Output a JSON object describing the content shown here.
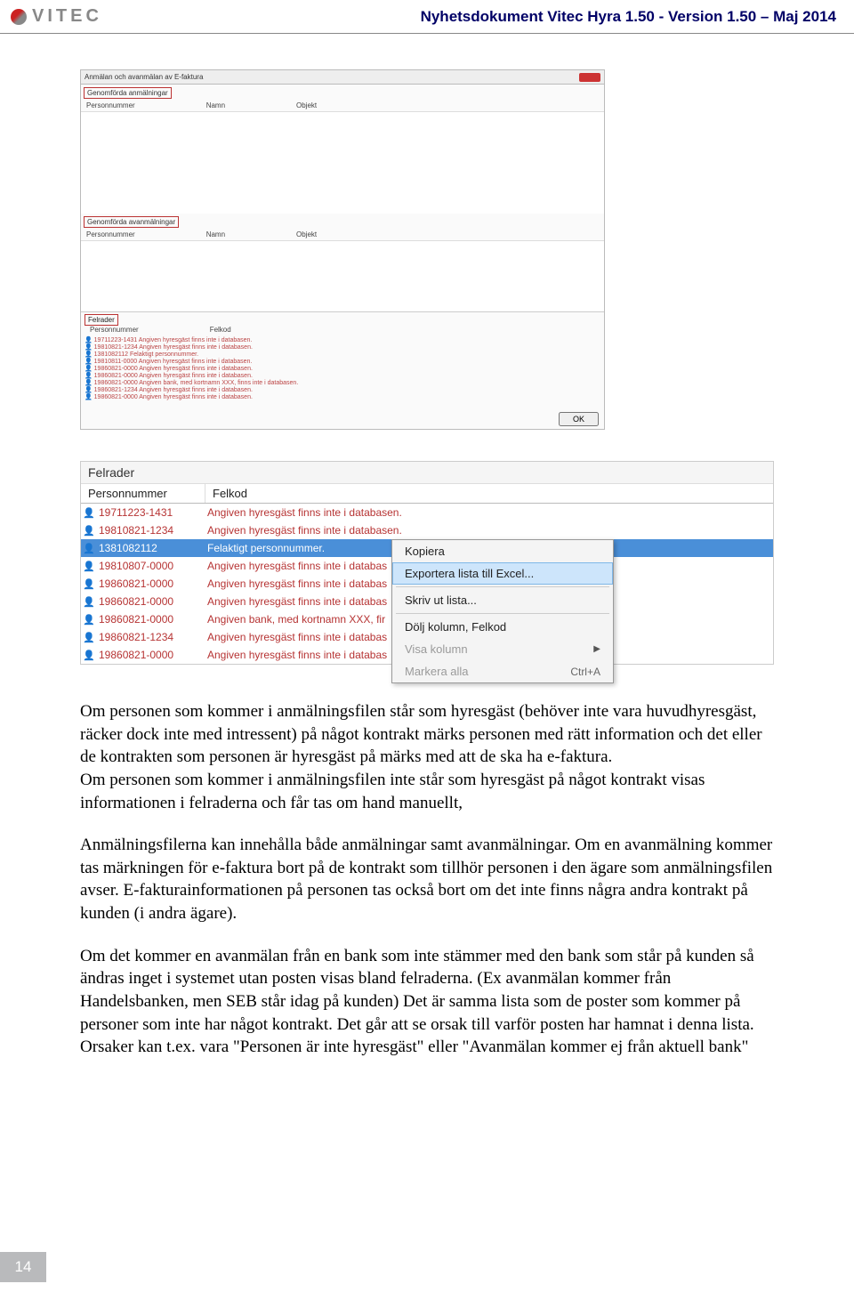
{
  "header": {
    "logo_text": "VITEC",
    "doc_title": "Nyhetsdokument Vitec Hyra 1.50 - Version 1.50 – Maj 2014"
  },
  "dialog1": {
    "title": "Anmälan och avanmälan av E-faktura",
    "sec_a": "Genomförda anmälningar",
    "col_pers": "Personnummer",
    "col_name": "Namn",
    "col_obj": "Objekt",
    "sec_b": "Genomförda avanmälningar",
    "sec_err": "Felrader",
    "col_felk": "Felkod",
    "err_msg_a": "Angiven hyresgäst finns inte i databasen.",
    "err_msg_b": "Felaktigt personnummer.",
    "err_msg_c": "Angiven bank, med kortnamn XXX, finns inte i databasen.",
    "err_rows": [
      "19711223-1431",
      "19810821-1234",
      "1381082112",
      "19810811-0000",
      "19860821-0000",
      "19860821-0000",
      "19860821-0000",
      "19860821-1234",
      "19860821-0000"
    ],
    "ok": "OK"
  },
  "panel2": {
    "title": "Felrader",
    "col1": "Personnummer",
    "col2": "Felkod",
    "rows": [
      {
        "id": "19711223-1431",
        "msg": "Angiven hyresgäst finns inte i databasen."
      },
      {
        "id": "19810821-1234",
        "msg": "Angiven hyresgäst finns inte i databasen."
      },
      {
        "id": "1381082112",
        "msg": "Felaktigt personnummer.",
        "sel": true
      },
      {
        "id": "19810807-0000",
        "msg": "Angiven hyresgäst finns inte i databas"
      },
      {
        "id": "19860821-0000",
        "msg": "Angiven hyresgäst finns inte i databas"
      },
      {
        "id": "19860821-0000",
        "msg": "Angiven hyresgäst finns inte i databas"
      },
      {
        "id": "19860821-0000",
        "msg": "Angiven bank, med kortnamn XXX, fir"
      },
      {
        "id": "19860821-1234",
        "msg": "Angiven hyresgäst finns inte i databas"
      },
      {
        "id": "19860821-0000",
        "msg": "Angiven hyresgäst finns inte i databas"
      }
    ]
  },
  "context_menu": {
    "copy": "Kopiera",
    "export": "Exportera lista till Excel...",
    "print": "Skriv ut lista...",
    "hide_col": "Dölj kolumn, Felkod",
    "show_col": "Visa kolumn",
    "select_all": "Markera alla",
    "select_all_shortcut": "Ctrl+A"
  },
  "body": {
    "p1": "Om personen som kommer i anmälningsfilen står som hyresgäst (behöver inte vara huvudhyresgäst, räcker dock inte med intressent) på något kontrakt märks personen med rätt information och det eller de kontrakten som personen är hyresgäst på märks med att de ska ha e-faktura.",
    "p2": "Om personen som kommer i anmälningsfilen inte står som hyresgäst på något kontrakt visas informationen i felraderna och får tas om hand manuellt,",
    "p3": "Anmälningsfilerna kan innehålla både anmälningar samt avanmälningar. Om en avanmälning kommer tas märkningen för e-faktura bort på de kontrakt som tillhör personen i den ägare som anmälningsfilen avser. E-fakturainformationen på personen tas också bort om det inte finns några andra kontrakt på kunden (i andra ägare).",
    "p4": "Om det kommer en avanmälan från en bank som inte stämmer med den bank som står på kunden så ändras inget i systemet utan posten visas bland felraderna. (Ex avanmälan kommer från Handelsbanken, men SEB står idag på kunden) Det är samma lista som de poster som kommer på personer som inte har något kontrakt. Det går att se orsak till varför posten har hamnat i denna lista. Orsaker kan t.ex. vara \"Personen är inte hyresgäst\" eller \"Avanmälan kommer ej från aktuell bank\""
  },
  "page_number": "14"
}
